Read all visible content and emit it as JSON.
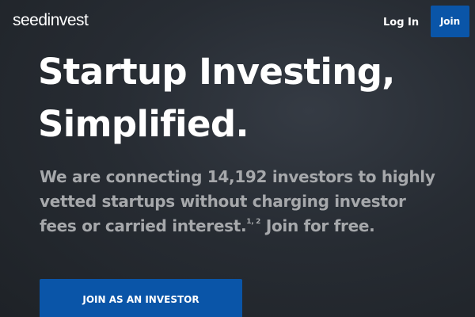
{
  "header": {
    "logo_text": "seedinvest",
    "login_label": "Log In",
    "join_label": "Join"
  },
  "hero": {
    "headline_line1": "Startup Investing,",
    "headline_line2": "Simplified.",
    "sub_line1": "We are connecting 14,192 investors to highly",
    "sub_line2": "vetted startups without charging investor",
    "sub_line3_a": "fees or carried interest.",
    "sub_line3_sup": "1, 2",
    "sub_line3_b": " Join for free.",
    "cta_label": "JOIN AS AN INVESTOR"
  },
  "colors": {
    "background": "#272c33",
    "brand_blue": "#0a55a8",
    "subtext": "#a6a8ab"
  }
}
